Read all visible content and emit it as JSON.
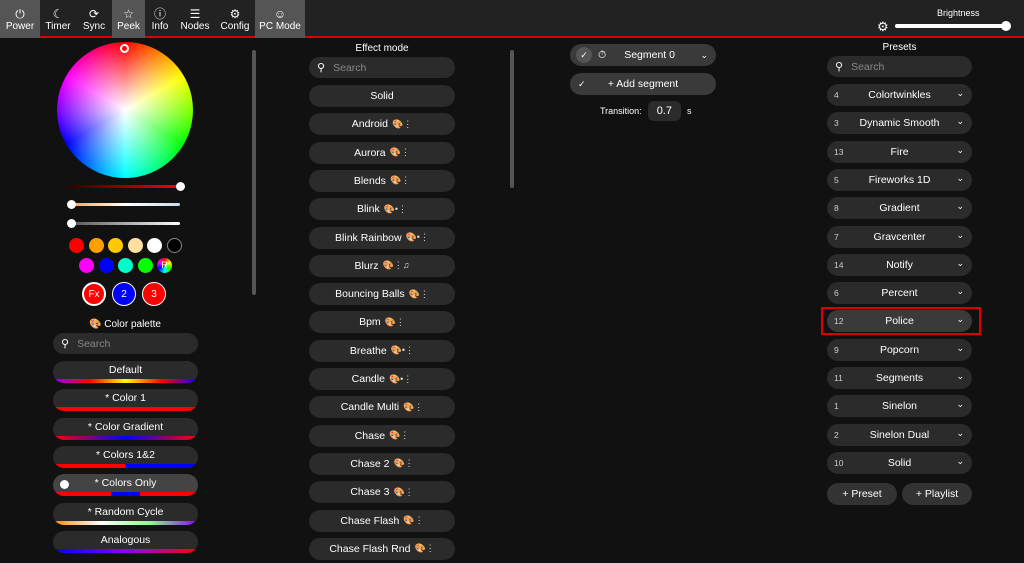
{
  "topbar": {
    "buttons": [
      {
        "label": "Power",
        "icon": "⏻",
        "on": true
      },
      {
        "label": "Timer",
        "icon": "☾",
        "on": false
      },
      {
        "label": "Sync",
        "icon": "⟳",
        "on": false
      },
      {
        "label": "Peek",
        "icon": "☆",
        "on": true
      },
      {
        "label": "Info",
        "icon": "ⓘ",
        "on": false
      },
      {
        "label": "Nodes",
        "icon": "☰",
        "on": false
      },
      {
        "label": "Config",
        "icon": "⚙",
        "on": false
      },
      {
        "label": "PC Mode",
        "icon": "☺",
        "on": true
      }
    ],
    "brightness_label": "Brightness",
    "brightness": 1.0
  },
  "colors": {
    "quick": [
      "#ff0000",
      "#ffa000",
      "#ffc800",
      "#ffe0a0",
      "#ffffff",
      "#000000",
      "#ff00ff",
      "#0000ff",
      "#00ffc8",
      "#08ff00"
    ],
    "random_label": "R",
    "slots": [
      {
        "label": "Fx",
        "color": "#ff0000"
      },
      {
        "label": "2",
        "color": "#0000ff"
      },
      {
        "label": "3",
        "color": "#ff0000"
      }
    ],
    "palette_title": "Color palette",
    "search_placeholder": "Search",
    "palettes": [
      {
        "name": "Default",
        "grad": "linear-gradient(90deg,#80f,#f00,#ff0,#f00,#00f)"
      },
      {
        "name": "* Color 1",
        "grad": "#f00"
      },
      {
        "name": "* Color Gradient",
        "grad": "linear-gradient(90deg,#f00,#00f,#f00)"
      },
      {
        "name": "* Colors 1&2",
        "grad": "linear-gradient(90deg,#f00 50%,#00f 50%)"
      },
      {
        "name": "* Colors Only",
        "grad": "linear-gradient(90deg,#f00 40%,#00f 40%,#00f 60%,#f00 60%)",
        "selected": true
      },
      {
        "name": "* Random Cycle",
        "grad": "linear-gradient(90deg,#f80,#fff,#8f8,#80f)"
      },
      {
        "name": "Analogous",
        "grad": "linear-gradient(90deg,#00f,#80f,#f00)"
      }
    ]
  },
  "effects": {
    "title": "Effect mode",
    "search_placeholder": "Search",
    "items": [
      {
        "name": "Solid",
        "flags": ""
      },
      {
        "name": "Android",
        "flags": "🎨⋮"
      },
      {
        "name": "Aurora",
        "flags": "🎨⋮"
      },
      {
        "name": "Blends",
        "flags": "🎨⋮"
      },
      {
        "name": "Blink",
        "flags": "🎨•⋮"
      },
      {
        "name": "Blink Rainbow",
        "flags": "🎨•⋮"
      },
      {
        "name": "Blurz",
        "flags": "🎨⋮♫"
      },
      {
        "name": "Bouncing Balls",
        "flags": "🎨⋮"
      },
      {
        "name": "Bpm",
        "flags": "🎨⋮"
      },
      {
        "name": "Breathe",
        "flags": "🎨•⋮"
      },
      {
        "name": "Candle",
        "flags": "🎨•⋮"
      },
      {
        "name": "Candle Multi",
        "flags": "🎨⋮"
      },
      {
        "name": "Chase",
        "flags": "🎨⋮"
      },
      {
        "name": "Chase 2",
        "flags": "🎨⋮"
      },
      {
        "name": "Chase 3",
        "flags": "🎨⋮"
      },
      {
        "name": "Chase Flash",
        "flags": "🎨⋮"
      },
      {
        "name": "Chase Flash Rnd",
        "flags": "🎨⋮"
      }
    ]
  },
  "segments": {
    "segment_name": "Segment 0",
    "add_label": "+ Add segment",
    "transition_label": "Transition:",
    "transition_value": "0.7",
    "transition_unit": "s"
  },
  "presets": {
    "title": "Presets",
    "search_placeholder": "Search",
    "items": [
      {
        "id": "4",
        "name": "Colortwinkles"
      },
      {
        "id": "3",
        "name": "Dynamic Smooth"
      },
      {
        "id": "13",
        "name": "Fire"
      },
      {
        "id": "5",
        "name": "Fireworks 1D"
      },
      {
        "id": "8",
        "name": "Gradient"
      },
      {
        "id": "7",
        "name": "Gravcenter"
      },
      {
        "id": "14",
        "name": "Notify"
      },
      {
        "id": "6",
        "name": "Percent"
      },
      {
        "id": "12",
        "name": "Police",
        "highlighted": true
      },
      {
        "id": "9",
        "name": "Popcorn"
      },
      {
        "id": "11",
        "name": "Segments"
      },
      {
        "id": "1",
        "name": "Sinelon"
      },
      {
        "id": "2",
        "name": "Sinelon Dual"
      },
      {
        "id": "10",
        "name": "Solid"
      }
    ],
    "add_preset": "+ Preset",
    "add_playlist": "+ Playlist"
  }
}
